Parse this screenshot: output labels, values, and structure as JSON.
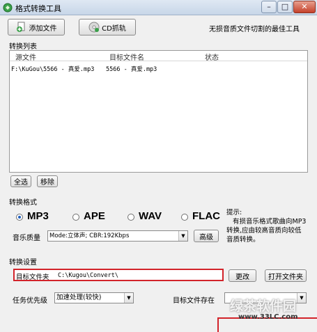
{
  "window": {
    "title": "格式转换工具",
    "min_glyph": "–",
    "max_glyph": "□",
    "close_glyph": "✕"
  },
  "toolbar": {
    "add_file_label": "添加文件",
    "cd_grab_label": "CD抓轨",
    "slogan": "无损音质文件切割的最佳工具"
  },
  "convert_list": {
    "section_title": "转换列表",
    "columns": [
      "源文件",
      "目标文件名",
      "状态"
    ],
    "rows": [
      {
        "source": "F:\\KuGou\\5566 - 真爱.mp3",
        "target": "5566 - 真爱.mp3",
        "status": ""
      }
    ]
  },
  "list_actions": {
    "select_all_label": "全选",
    "remove_label": "移除"
  },
  "format": {
    "section_title": "转换格式",
    "options": [
      "MP3",
      "APE",
      "WAV",
      "FLAC"
    ],
    "selected": "MP3",
    "quality_label": "音乐质量",
    "quality_value": "Mode:立体声; CBR:192Kbps",
    "advanced_label": "高级",
    "hint_title": "提示:",
    "hint_lines": [
      "有损音乐格式歌曲向MP3",
      "转换,应由较高音质向较低",
      "音质转换。"
    ]
  },
  "settings": {
    "section_title": "转换设置",
    "target_folder_label": "目标文件夹",
    "target_folder_value": "C:\\Kugou\\Convert\\",
    "change_label": "更改",
    "open_folder_label": "打开文件夹",
    "priority_label": "任务优先级",
    "priority_value": "加速处理(较快)",
    "target_exists_label": "目标文件存在"
  },
  "watermark": {
    "logo_text": "绿茶软件园",
    "url": "www.33LC.com"
  },
  "colors": {
    "highlight_border": "#d2232a",
    "radio_dot": "#1f5fbf"
  }
}
